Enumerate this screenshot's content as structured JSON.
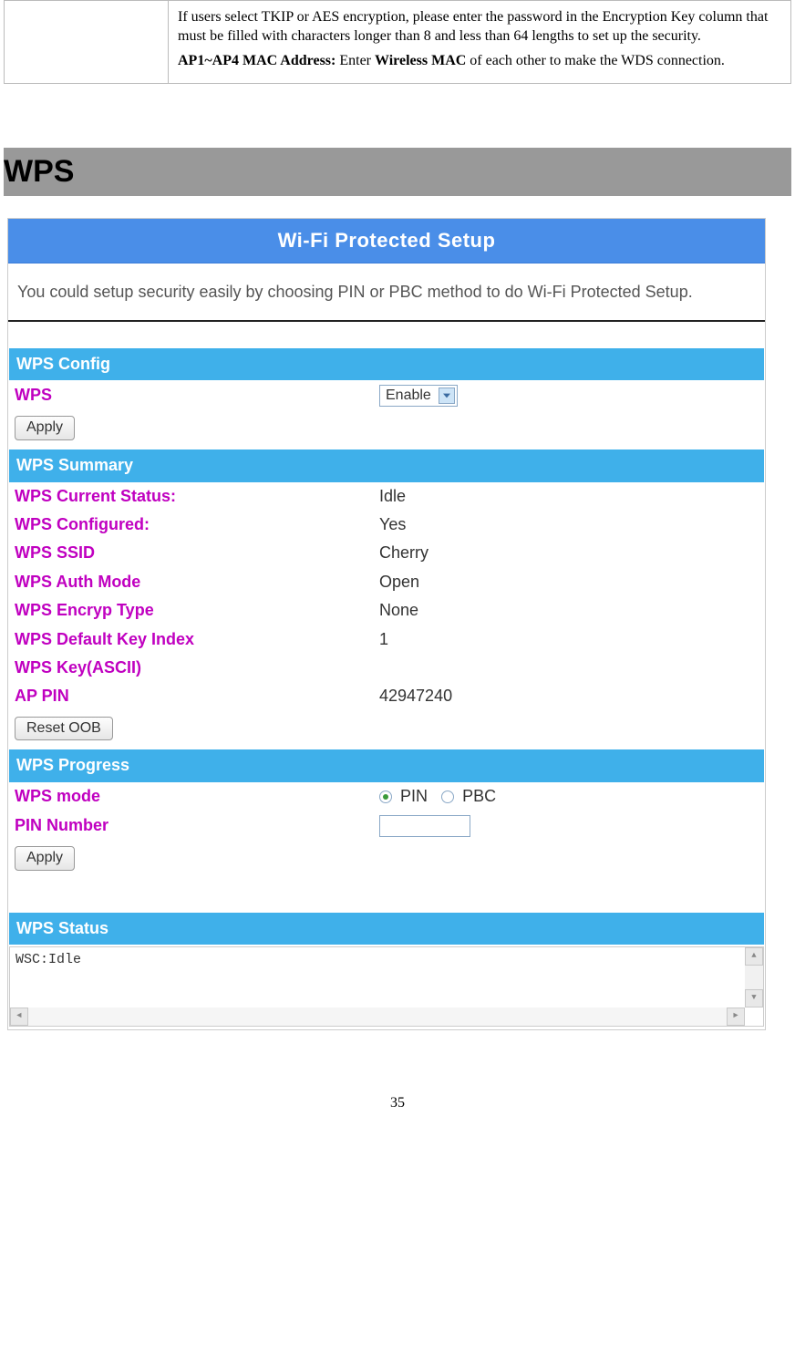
{
  "top_desc": {
    "paragraph1": "If users select TKIP or AES encryption, please enter the password in the Encryption Key column that must be filled with characters longer than 8 and less than 64 lengths to set up the security.",
    "ap_label": "AP1~AP4 MAC Address:",
    "ap_text_before": " Enter ",
    "ap_bold": "Wireless MAC",
    "ap_text_after": " of each other to make the WDS connection."
  },
  "section_title": "WPS",
  "panel": {
    "title": "Wi-Fi Protected Setup",
    "intro": "You could setup security easily by choosing PIN or PBC method to do Wi-Fi Protected Setup.",
    "config": {
      "header": "WPS Config",
      "wps_label": "WPS",
      "wps_value": "Enable",
      "apply": "Apply"
    },
    "summary": {
      "header": "WPS Summary",
      "rows": [
        {
          "label": "WPS Current Status:",
          "value": "Idle"
        },
        {
          "label": "WPS Configured:",
          "value": "Yes"
        },
        {
          "label": "WPS SSID",
          "value": "Cherry"
        },
        {
          "label": "WPS Auth Mode",
          "value": "Open"
        },
        {
          "label": "WPS Encryp Type",
          "value": "None"
        },
        {
          "label": "WPS Default Key Index",
          "value": "1"
        },
        {
          "label": "WPS Key(ASCII)",
          "value": ""
        },
        {
          "label": "AP PIN",
          "value": "42947240"
        }
      ],
      "reset_button": "Reset OOB"
    },
    "progress": {
      "header": "WPS Progress",
      "mode_label": "WPS mode",
      "mode_options": [
        {
          "label": "PIN",
          "checked": true
        },
        {
          "label": "PBC",
          "checked": false
        }
      ],
      "pin_label": "PIN Number",
      "pin_value": "",
      "apply": "Apply"
    },
    "status": {
      "header": "WPS Status",
      "text": "WSC:Idle"
    }
  },
  "page_number": "35"
}
